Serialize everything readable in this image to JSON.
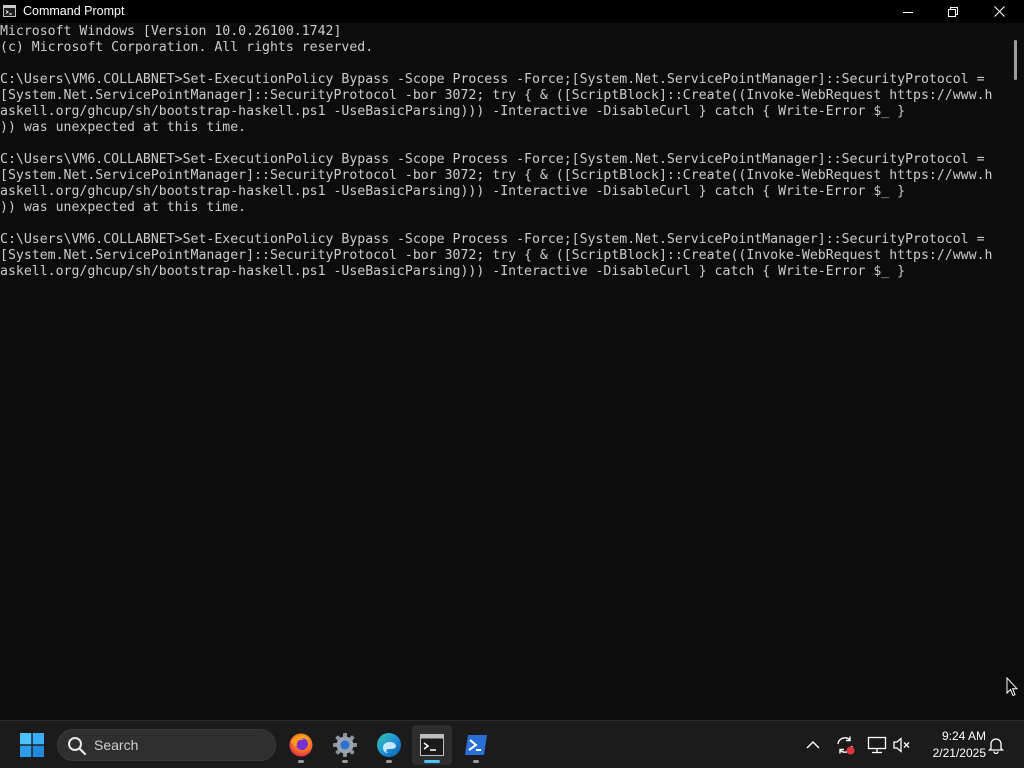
{
  "window": {
    "title": "Command Prompt",
    "app_icon": "cmd-icon",
    "controls": {
      "minimize_icon": "minimize-icon",
      "maximize_icon": "restore-icon",
      "close_icon": "close-icon"
    }
  },
  "console": {
    "text_color": "#cccccc",
    "background": "#0c0c0c",
    "lines": [
      "Microsoft Windows [Version 10.0.26100.1742]",
      "(c) Microsoft Corporation. All rights reserved.",
      "",
      "C:\\Users\\VM6.COLLABNET>Set-ExecutionPolicy Bypass -Scope Process -Force;[System.Net.ServicePointManager]::SecurityProtocol =",
      "[System.Net.ServicePointManager]::SecurityProtocol -bor 3072; try { & ([ScriptBlock]::Create((Invoke-WebRequest https://www.h",
      "askell.org/ghcup/sh/bootstrap-haskell.ps1 -UseBasicParsing))) -Interactive -DisableCurl } catch { Write-Error $_ }",
      ")) was unexpected at this time.",
      "",
      "C:\\Users\\VM6.COLLABNET>Set-ExecutionPolicy Bypass -Scope Process -Force;[System.Net.ServicePointManager]::SecurityProtocol =",
      "[System.Net.ServicePointManager]::SecurityProtocol -bor 3072; try { & ([ScriptBlock]::Create((Invoke-WebRequest https://www.h",
      "askell.org/ghcup/sh/bootstrap-haskell.ps1 -UseBasicParsing))) -Interactive -DisableCurl } catch { Write-Error $_ }",
      ")) was unexpected at this time.",
      "",
      "C:\\Users\\VM6.COLLABNET>Set-ExecutionPolicy Bypass -Scope Process -Force;[System.Net.ServicePointManager]::SecurityProtocol =",
      "[System.Net.ServicePointManager]::SecurityProtocol -bor 3072; try { & ([ScriptBlock]::Create((Invoke-WebRequest https://www.h",
      "askell.org/ghcup/sh/bootstrap-haskell.ps1 -UseBasicParsing))) -Interactive -DisableCurl } catch { Write-Error $_ }"
    ]
  },
  "taskbar": {
    "start_icon": "windows-start-icon",
    "search": {
      "label": "Search",
      "icon": "search-icon"
    },
    "apps": [
      {
        "name": "firefox",
        "icon": "firefox-icon",
        "active": false
      },
      {
        "name": "settings",
        "icon": "settings-gear-icon",
        "active": false
      },
      {
        "name": "edge",
        "icon": "edge-icon",
        "active": false
      },
      {
        "name": "command-prompt",
        "icon": "cmd-icon",
        "active": true
      },
      {
        "name": "powershell",
        "icon": "powershell-icon",
        "active": false
      }
    ],
    "tray": {
      "chevron_icon": "chevron-up-icon",
      "sync_icon": "sync-alert-icon",
      "network_icon": "network-icon",
      "volume_icon": "volume-muted-icon",
      "bell_icon": "notification-bell-icon"
    },
    "clock": {
      "time": "9:24 AM",
      "date": "2/21/2025"
    }
  },
  "colors": {
    "taskbar_bg": "#1b1b1b",
    "accent": "#4cc2ff",
    "titlebar_bg": "#000000"
  }
}
